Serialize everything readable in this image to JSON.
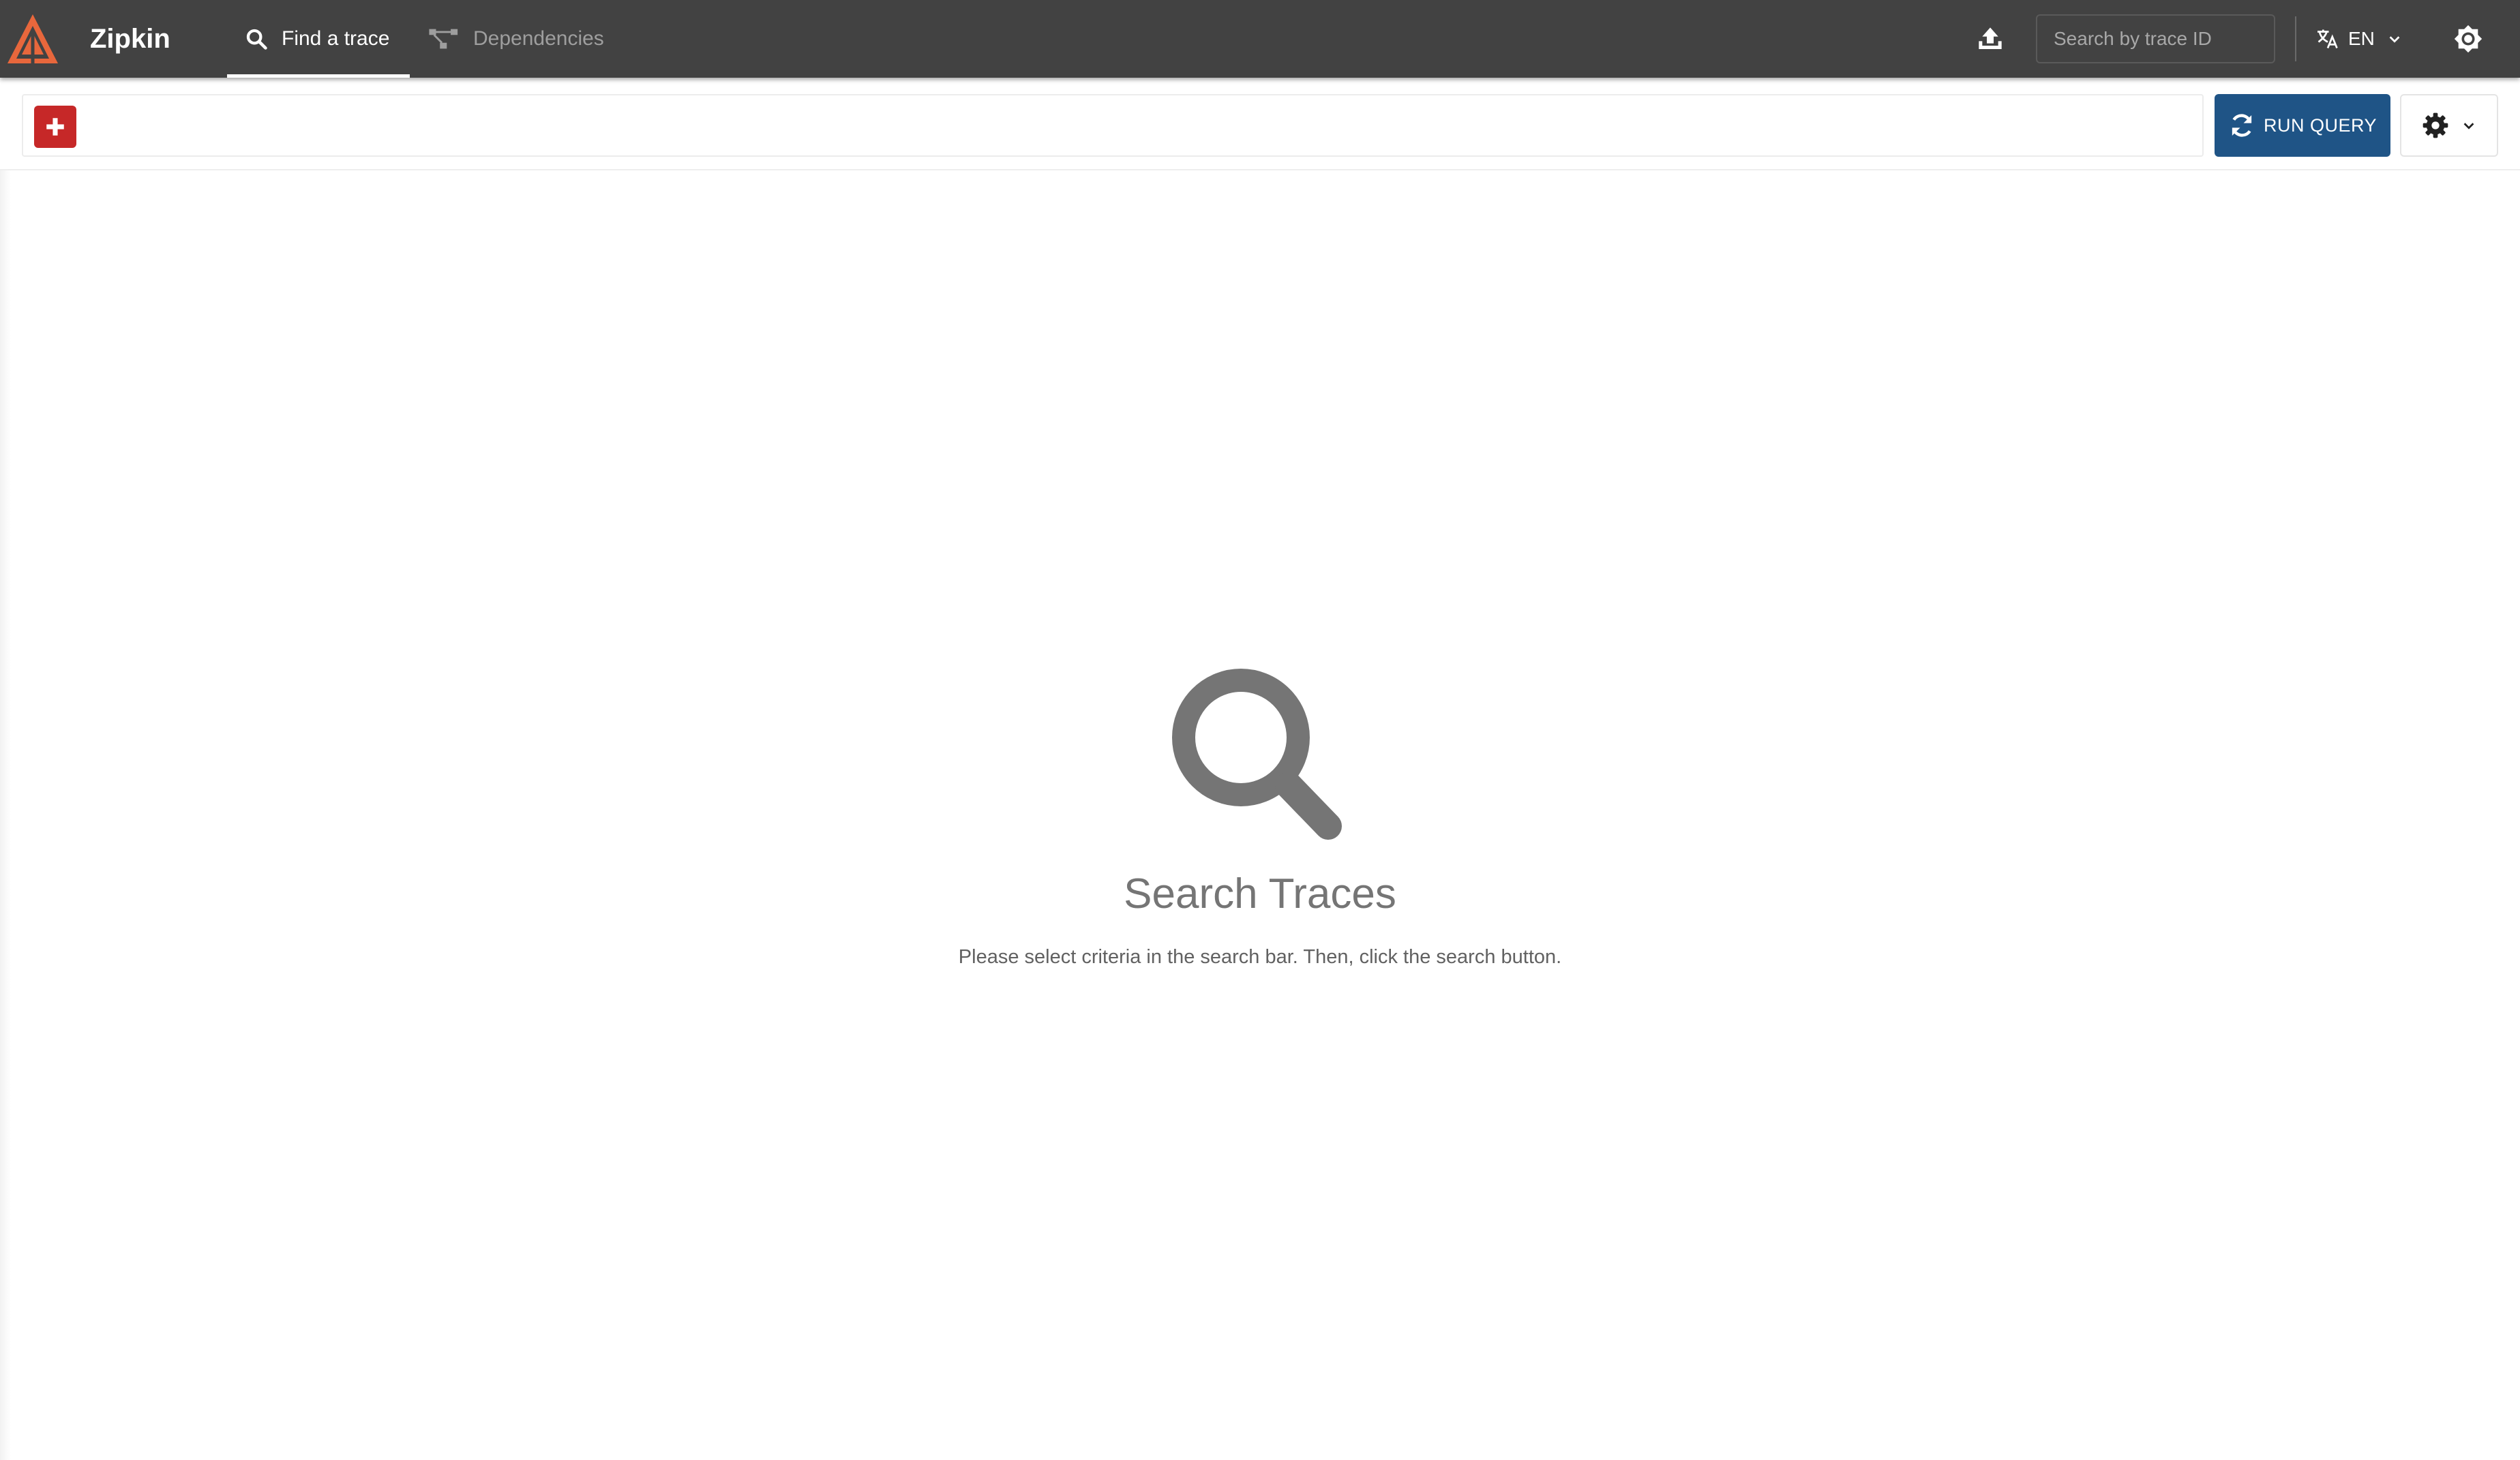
{
  "app": {
    "brand": "Zipkin",
    "logo_icon": "zipkin-logo",
    "accent_color": "#e8673c"
  },
  "nav": {
    "tabs": [
      {
        "label": "Find a trace",
        "icon": "search-icon",
        "active": true
      },
      {
        "label": "Dependencies",
        "icon": "dependencies-icon",
        "active": false
      }
    ]
  },
  "header": {
    "upload_icon": "upload-icon",
    "trace_search": {
      "placeholder": "Search by trace ID",
      "value": ""
    },
    "language": {
      "icon": "translate-icon",
      "label": "EN"
    },
    "theme_icon": "brightness-icon"
  },
  "toolbar": {
    "add_icon": "plus-icon",
    "run_query_label": "RUN QUERY",
    "run_query_icon": "refresh-icon",
    "run_query_color": "#1f5486",
    "add_button_color": "#c62828",
    "settings_icon": "gear-icon"
  },
  "empty_state": {
    "icon": "search-icon",
    "title": "Search Traces",
    "description": "Please select criteria in the search bar. Then, click the search button."
  }
}
